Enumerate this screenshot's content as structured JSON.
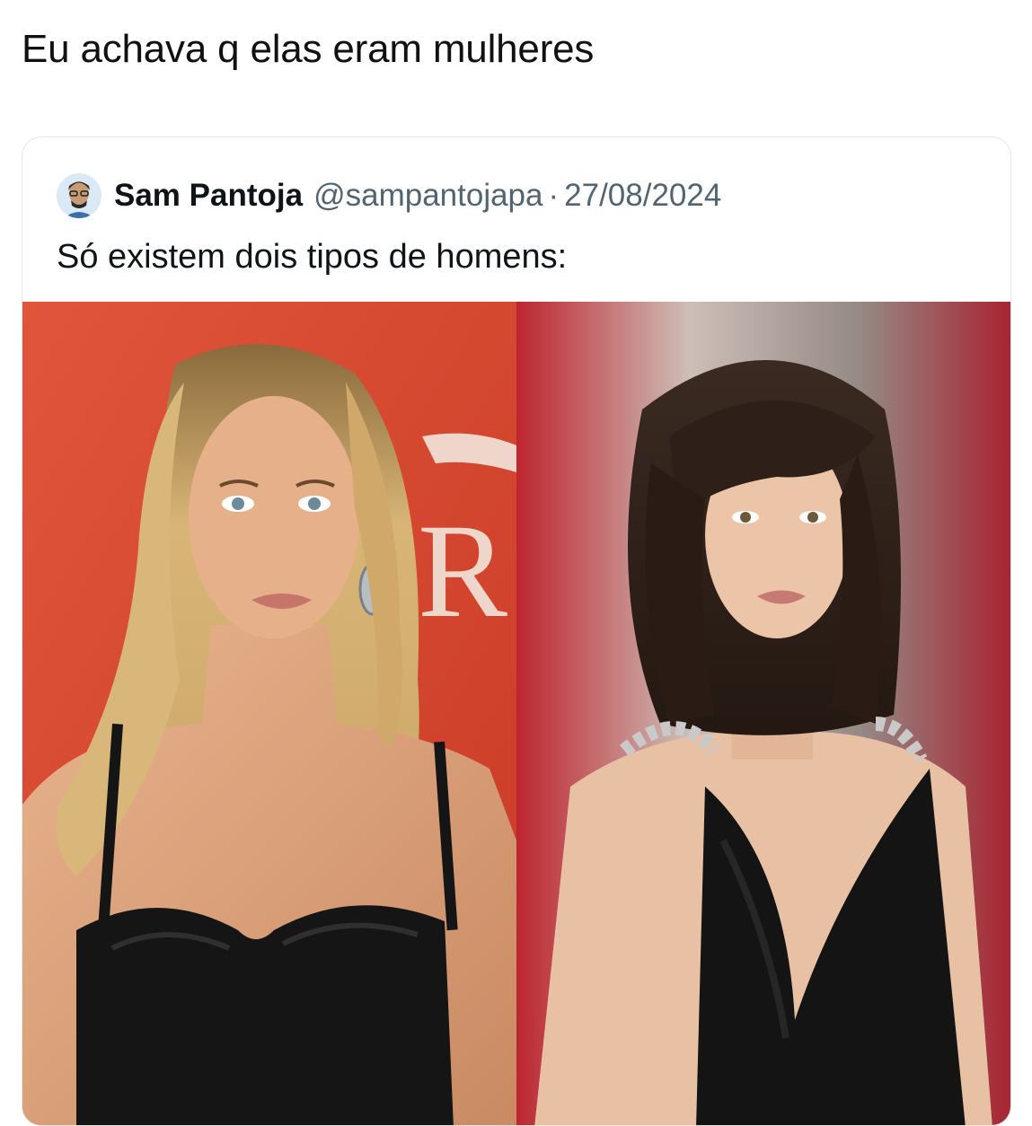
{
  "caption": "Eu achava q elas eram mulheres",
  "quoted_tweet": {
    "author_name": "Sam Pantoja",
    "handle": "@sampantojapa",
    "separator": "·",
    "date": "27/08/2024",
    "text": "Só existem dois tipos de homens:",
    "avatar_icon": "user-avatar",
    "media": [
      {
        "description_icon": "photo-woman-blonde-red-backdrop"
      },
      {
        "description_icon": "photo-woman-brunette-red-carpet"
      }
    ]
  },
  "colors": {
    "text_primary": "#0f1419",
    "text_secondary": "#536471",
    "card_border": "#e3e6e8",
    "backdrop_red": "#d9482e",
    "carpet_red": "#a8101c"
  }
}
